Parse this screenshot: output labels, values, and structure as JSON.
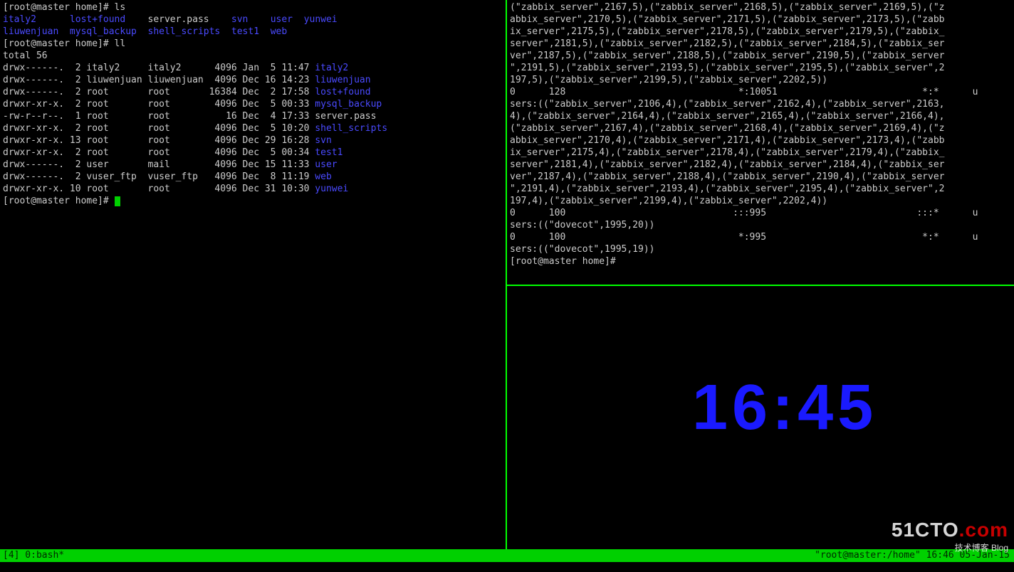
{
  "left": {
    "prompt1": "[root@master home]# ls",
    "ls_row1": [
      {
        "t": "italy2      ",
        "c": "blue"
      },
      {
        "t": "lost+found    ",
        "c": "blue"
      },
      {
        "t": "server.pass    ",
        "c": "white"
      },
      {
        "t": "svn    ",
        "c": "blue"
      },
      {
        "t": "user  ",
        "c": "blue"
      },
      {
        "t": "yunwei",
        "c": "blue"
      }
    ],
    "ls_row2": [
      {
        "t": "liuwenjuan  ",
        "c": "blue"
      },
      {
        "t": "mysql_backup  ",
        "c": "blue"
      },
      {
        "t": "shell_scripts  ",
        "c": "blue"
      },
      {
        "t": "test1  ",
        "c": "blue"
      },
      {
        "t": "web",
        "c": "blue"
      }
    ],
    "prompt2": "[root@master home]# ll",
    "total": "total 56",
    "rows": [
      {
        "p": "drwx------.  2 italy2     italy2      4096 Jan  5 11:47 ",
        "n": "italy2",
        "c": "blue"
      },
      {
        "p": "drwx------.  2 liuwenjuan liuwenjuan  4096 Dec 16 14:23 ",
        "n": "liuwenjuan",
        "c": "blue"
      },
      {
        "p": "drwx------.  2 root       root       16384 Dec  2 17:58 ",
        "n": "lost+found",
        "c": "blue"
      },
      {
        "p": "drwxr-xr-x.  2 root       root        4096 Dec  5 00:33 ",
        "n": "mysql_backup",
        "c": "blue"
      },
      {
        "p": "-rw-r--r--.  1 root       root          16 Dec  4 17:33 ",
        "n": "server.pass",
        "c": "white"
      },
      {
        "p": "drwxr-xr-x.  2 root       root        4096 Dec  5 10:20 ",
        "n": "shell_scripts",
        "c": "blue"
      },
      {
        "p": "drwxr-xr-x. 13 root       root        4096 Dec 29 16:28 ",
        "n": "svn",
        "c": "blue"
      },
      {
        "p": "drwxr-xr-x.  2 root       root        4096 Dec  5 00:34 ",
        "n": "test1",
        "c": "blue"
      },
      {
        "p": "drwx------.  2 user       mail        4096 Dec 15 11:33 ",
        "n": "user",
        "c": "blue"
      },
      {
        "p": "drwx------.  2 vuser_ftp  vuser_ftp   4096 Dec  8 11:19 ",
        "n": "web",
        "c": "blue"
      },
      {
        "p": "drwxr-xr-x. 10 root       root        4096 Dec 31 10:30 ",
        "n": "yunwei",
        "c": "blue"
      }
    ],
    "prompt3": "[root@master home]# "
  },
  "right_top": {
    "lines": [
      "(\"zabbix_server\",2167,5),(\"zabbix_server\",2168,5),(\"zabbix_server\",2169,5),(\"z",
      "abbix_server\",2170,5),(\"zabbix_server\",2171,5),(\"zabbix_server\",2173,5),(\"zabb",
      "ix_server\",2175,5),(\"zabbix_server\",2178,5),(\"zabbix_server\",2179,5),(\"zabbix_",
      "server\",2181,5),(\"zabbix_server\",2182,5),(\"zabbix_server\",2184,5),(\"zabbix_ser",
      "ver\",2187,5),(\"zabbix_server\",2188,5),(\"zabbix_server\",2190,5),(\"zabbix_server",
      "\",2191,5),(\"zabbix_server\",2193,5),(\"zabbix_server\",2195,5),(\"zabbix_server\",2",
      "197,5),(\"zabbix_server\",2199,5),(\"zabbix_server\",2202,5))",
      "0      128                               *:10051                          *:*      u",
      "sers:((\"zabbix_server\",2106,4),(\"zabbix_server\",2162,4),(\"zabbix_server\",2163,",
      "4),(\"zabbix_server\",2164,4),(\"zabbix_server\",2165,4),(\"zabbix_server\",2166,4),",
      "(\"zabbix_server\",2167,4),(\"zabbix_server\",2168,4),(\"zabbix_server\",2169,4),(\"z",
      "abbix_server\",2170,4),(\"zabbix_server\",2171,4),(\"zabbix_server\",2173,4),(\"zabb",
      "ix_server\",2175,4),(\"zabbix_server\",2178,4),(\"zabbix_server\",2179,4),(\"zabbix_",
      "server\",2181,4),(\"zabbix_server\",2182,4),(\"zabbix_server\",2184,4),(\"zabbix_ser",
      "ver\",2187,4),(\"zabbix_server\",2188,4),(\"zabbix_server\",2190,4),(\"zabbix_server",
      "\",2191,4),(\"zabbix_server\",2193,4),(\"zabbix_server\",2195,4),(\"zabbix_server\",2",
      "197,4),(\"zabbix_server\",2199,4),(\"zabbix_server\",2202,4))",
      "0      100                              :::995                           :::*      u",
      "sers:((\"dovecot\",1995,20))",
      "0      100                               *:995                            *:*      u",
      "sers:((\"dovecot\",1995,19))",
      "[root@master home]#"
    ]
  },
  "clock": "16:45",
  "status": {
    "left": "[4] 0:bash*",
    "right": "\"root@master:/home\" 16:46 05-Jan-15"
  },
  "watermark": {
    "brand": "51CTO",
    "suffix": ".com",
    "tag": "技术博客  Blog",
    "url": ""
  }
}
